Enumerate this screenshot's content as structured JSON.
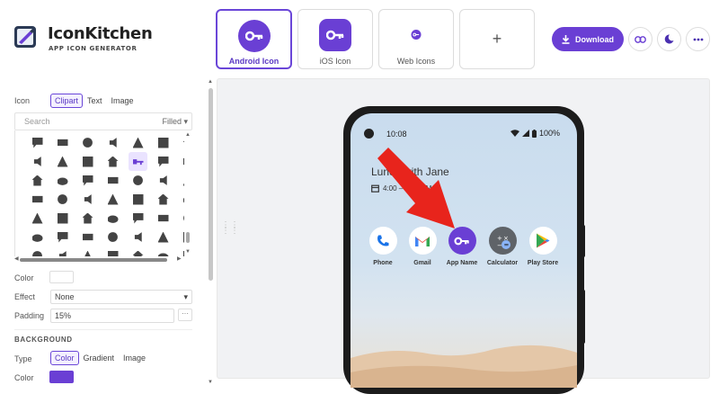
{
  "brand": {
    "title": "IconKitchen",
    "subtitle": "APP ICON GENERATOR"
  },
  "targets": [
    {
      "label": "Android Icon",
      "active": true
    },
    {
      "label": "iOS Icon",
      "active": false
    },
    {
      "label": "Web Icons",
      "active": false
    },
    {
      "label": "+",
      "active": false
    }
  ],
  "toolbar": {
    "download_label": "Download",
    "link_icon": "link-icon",
    "theme_icon": "moon-icon",
    "more_icon": "more-icon"
  },
  "icon_panel": {
    "label": "Icon",
    "modes": [
      "Clipart",
      "Text",
      "Image"
    ],
    "active_mode": "Clipart",
    "search_placeholder": "Search",
    "filter": "Filled",
    "selected_icon": "key-icon"
  },
  "properties": {
    "color_label": "Color",
    "effect_label": "Effect",
    "effect_value": "None",
    "padding_label": "Padding",
    "padding_value": "15%",
    "padding_more": "···"
  },
  "background": {
    "heading": "BACKGROUND",
    "type_label": "Type",
    "types": [
      "Color",
      "Gradient",
      "Image"
    ],
    "active_type": "Color",
    "color_label": "Color",
    "color": "#6a3fd4"
  },
  "preview": {
    "time": "10:08",
    "battery": "100%",
    "event_title": "Lunch with Jane",
    "event_time": "4:00 – 4:30 PM",
    "apps": [
      "Phone",
      "Gmail",
      "App Name",
      "Calculator",
      "Play Store"
    ]
  },
  "colors": {
    "accent": "#6a3fd4",
    "annotation_arrow": "#e8241c"
  }
}
